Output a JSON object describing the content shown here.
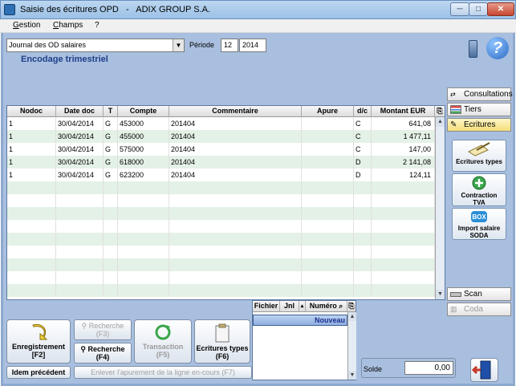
{
  "window": {
    "title": "Saisie des écritures OPD   -   ADIX GROUP S.A.",
    "btn_min": "─",
    "btn_max": "□",
    "btn_close": "✕"
  },
  "menu": {
    "items": [
      {
        "u": "G",
        "rest": "estion"
      },
      {
        "u": "C",
        "rest": "hamps"
      },
      {
        "u": "?",
        "rest": ""
      }
    ]
  },
  "form": {
    "journal": "Journal des OD salaires",
    "periode_label": "Période",
    "periode_month": "12",
    "periode_year": "2014",
    "subtitle": "Encodage trimestriel",
    "help_glyph": "?"
  },
  "grid": {
    "columns": [
      "Nodoc",
      "Date doc",
      "T",
      "Compte",
      "Commentaire",
      "Apure",
      "d/c",
      "Montant EUR"
    ],
    "rows": [
      [
        "1",
        "30/04/2014",
        "G",
        "453000",
        "201404",
        "",
        "C",
        "641,08"
      ],
      [
        "1",
        "30/04/2014",
        "G",
        "455000",
        "201404",
        "",
        "C",
        "1 477,11"
      ],
      [
        "1",
        "30/04/2014",
        "G",
        "575000",
        "201404",
        "",
        "C",
        "147,00"
      ],
      [
        "1",
        "30/04/2014",
        "G",
        "618000",
        "201404",
        "",
        "D",
        "2 141,08"
      ],
      [
        "1",
        "30/04/2014",
        "G",
        "623200",
        "201404",
        "",
        "D",
        "124,11"
      ]
    ]
  },
  "side_tabs": {
    "consultations": "Consultations",
    "tiers": "Tiers",
    "ecritures": "Ecritures",
    "scan": "Scan",
    "coda": "Coda"
  },
  "side_buttons": {
    "ecritures_types": "Ecritures types",
    "contraction_l1": "Contraction",
    "contraction_l2": "TVA",
    "import_l1": "Import salaire",
    "import_l2": "SODA",
    "box_label": "BOX"
  },
  "bottom_grid": {
    "columns": [
      "Fichier",
      "Jnl",
      "Numéro"
    ],
    "row_value": "Nouveau"
  },
  "buttons": {
    "enregistrement_l1": "Enregistrement",
    "enregistrement_l2": "[F2]",
    "recherche_f3_l1": "Recherche",
    "recherche_f3_l2": "(F3)",
    "recherche_f4_l1": "Recherche",
    "recherche_f4_l2": "(F4)",
    "transaction_l1": "Transaction",
    "transaction_l2": "(F5)",
    "ecritures_types_l1": "Ecritures types",
    "ecritures_types_l2": "(F6)",
    "idem_precedent": "Idem précédent",
    "enlever_apurement": "Enlever l'apurement de la ligne en-cours (F7)"
  },
  "solde": {
    "label": "Solde",
    "value": "0,00"
  },
  "colors": {
    "background": "#a9bfdf",
    "row_alt": "#e4f1e6",
    "subtitle": "#1f3f8a"
  }
}
